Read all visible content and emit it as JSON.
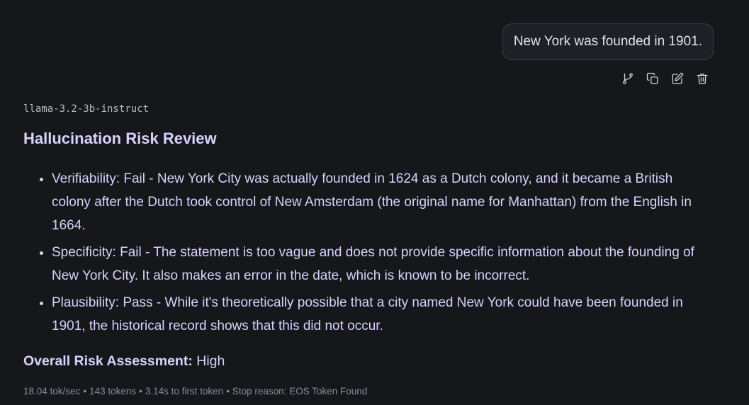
{
  "user_message": {
    "text": "New York was founded in 1901."
  },
  "message_actions": [
    {
      "icon": "branch-icon"
    },
    {
      "icon": "copy-icon"
    },
    {
      "icon": "edit-icon"
    },
    {
      "icon": "trash-icon"
    }
  ],
  "assistant": {
    "model": "llama-3.2-3b-instruct",
    "heading": "Hallucination Risk Review",
    "items": [
      "Verifiability: Fail - New York City was actually founded in 1624 as a Dutch colony, and it became a British colony after the Dutch took control of New Amsterdam (the original name for Manhattan) from the English in 1664.",
      "Specificity: Fail - The statement is too vague and does not provide specific information about the founding of New York City. It also makes an error in the date, which is known to be incorrect.",
      "Plausibility: Pass - While it's theoretically possible that a city named New York could have been founded in 1901, the historical record shows that this did not occur."
    ],
    "overall_label": "Overall Risk Assessment:",
    "overall_value": "High"
  },
  "stats": {
    "speed": "18.04 tok/sec",
    "tokens": "143 tokens",
    "first_token": "3.14s to first token",
    "stop_reason": "Stop reason: EOS Token Found",
    "separator": "•"
  }
}
